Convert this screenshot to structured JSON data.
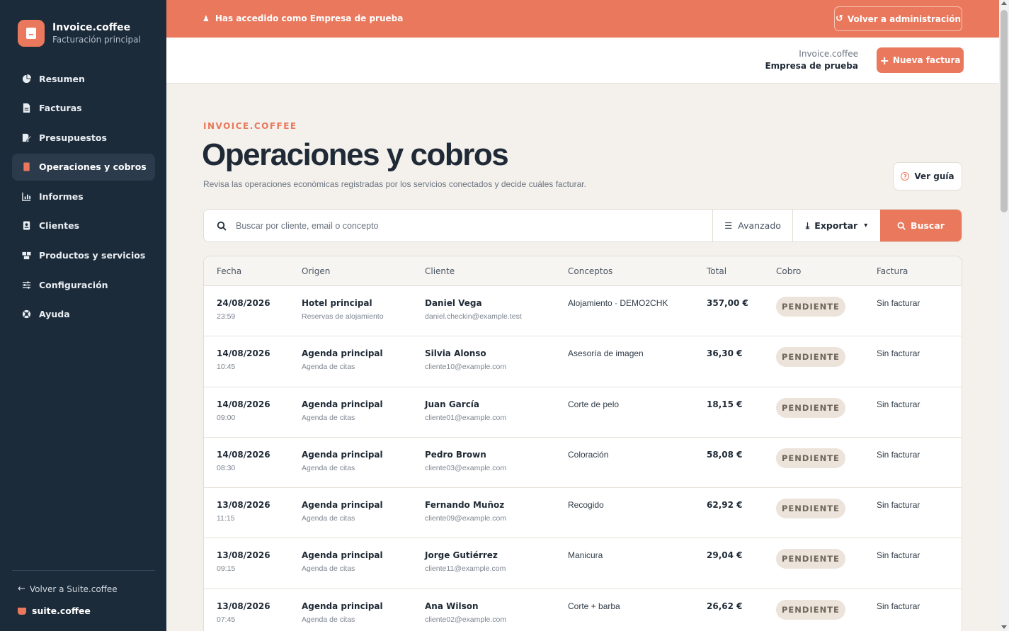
{
  "colors": {
    "accent": "#e9785d",
    "sidebar_bg": "#1c2b3a",
    "page_bg": "#f4f1ec",
    "badge_bg": "#ece3da"
  },
  "sidebar": {
    "brand_title": "Invoice.coffee",
    "brand_sub": "Facturación principal",
    "items": [
      {
        "label": "Resumen",
        "icon": "pie-chart-icon"
      },
      {
        "label": "Facturas",
        "icon": "document-icon"
      },
      {
        "label": "Presupuestos",
        "icon": "edit-document-icon"
      },
      {
        "label": "Operaciones y cobros",
        "icon": "receipt-icon",
        "active": true
      },
      {
        "label": "Informes",
        "icon": "bar-chart-icon"
      },
      {
        "label": "Clientes",
        "icon": "contact-card-icon"
      },
      {
        "label": "Productos y servicios",
        "icon": "boxes-icon"
      },
      {
        "label": "Configuración",
        "icon": "sliders-icon"
      },
      {
        "label": "Ayuda",
        "icon": "lifebuoy-icon"
      }
    ],
    "back_label": "Volver a Suite.coffee",
    "suite_label": "suite.coffee"
  },
  "banner": {
    "text": "Has accedido como Empresa de prueba",
    "admin_button": "Volver a administración"
  },
  "header": {
    "brand_line1": "Invoice.coffee",
    "brand_line2": "Empresa de prueba",
    "new_invoice_button": "Nueva factura"
  },
  "main": {
    "eyebrow": "INVOICE.COFFEE",
    "title": "Operaciones y cobros",
    "description": "Revisa las operaciones económicas registradas por los servicios conectados y decide cuáles facturar.",
    "guide_button": "Ver guía"
  },
  "search": {
    "placeholder": "Buscar por cliente, email o concepto",
    "advanced_label": "Avanzado",
    "export_label": "Exportar",
    "search_button": "Buscar"
  },
  "table": {
    "headers": {
      "fecha": "Fecha",
      "origen": "Origen",
      "cliente": "Cliente",
      "conceptos": "Conceptos",
      "total": "Total",
      "cobro": "Cobro",
      "factura": "Factura"
    },
    "rows": [
      {
        "date": "24/08/2026",
        "time": "23:59",
        "origin": "Hotel principal",
        "origin_sub": "Reservas de alojamiento",
        "client": "Daniel Vega",
        "email": "daniel.checkin@example.test",
        "concept": "Alojamiento · DEMO2CHK",
        "total": "357,00 €",
        "status": "PENDIENTE",
        "invoice": "Sin facturar"
      },
      {
        "date": "14/08/2026",
        "time": "10:45",
        "origin": "Agenda principal",
        "origin_sub": "Agenda de citas",
        "client": "Silvia Alonso",
        "email": "cliente10@example.com",
        "concept": "Asesoría de imagen",
        "total": "36,30 €",
        "status": "PENDIENTE",
        "invoice": "Sin facturar"
      },
      {
        "date": "14/08/2026",
        "time": "09:00",
        "origin": "Agenda principal",
        "origin_sub": "Agenda de citas",
        "client": "Juan García",
        "email": "cliente01@example.com",
        "concept": "Corte de pelo",
        "total": "18,15 €",
        "status": "PENDIENTE",
        "invoice": "Sin facturar"
      },
      {
        "date": "14/08/2026",
        "time": "08:30",
        "origin": "Agenda principal",
        "origin_sub": "Agenda de citas",
        "client": "Pedro Brown",
        "email": "cliente03@example.com",
        "concept": "Coloración",
        "total": "58,08 €",
        "status": "PENDIENTE",
        "invoice": "Sin facturar"
      },
      {
        "date": "13/08/2026",
        "time": "11:15",
        "origin": "Agenda principal",
        "origin_sub": "Agenda de citas",
        "client": "Fernando Muñoz",
        "email": "cliente09@example.com",
        "concept": "Recogido",
        "total": "62,92 €",
        "status": "PENDIENTE",
        "invoice": "Sin facturar"
      },
      {
        "date": "13/08/2026",
        "time": "09:15",
        "origin": "Agenda principal",
        "origin_sub": "Agenda de citas",
        "client": "Jorge Gutiérrez",
        "email": "cliente11@example.com",
        "concept": "Manicura",
        "total": "29,04 €",
        "status": "PENDIENTE",
        "invoice": "Sin facturar"
      },
      {
        "date": "13/08/2026",
        "time": "07:45",
        "origin": "Agenda principal",
        "origin_sub": "Agenda de citas",
        "client": "Ana Wilson",
        "email": "cliente02@example.com",
        "concept": "Corte + barba",
        "total": "26,62 €",
        "status": "PENDIENTE",
        "invoice": "Sin facturar"
      }
    ]
  }
}
